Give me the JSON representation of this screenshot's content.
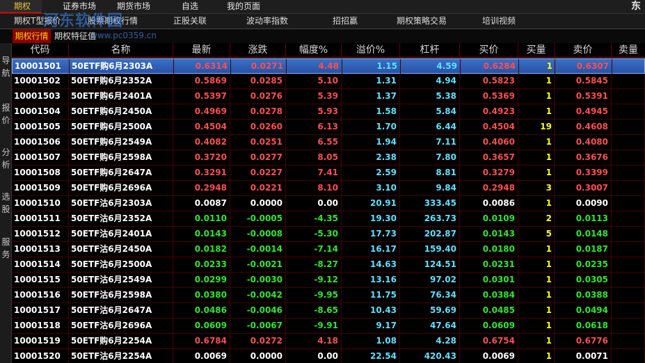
{
  "topbar": {
    "menus": [
      "期权",
      "证券市场",
      "期货市场",
      "自选",
      "我的页面"
    ],
    "brand_char": "东"
  },
  "tabbar": {
    "tabs": [
      "期权T型报价",
      "股票期权行情",
      "正股关联",
      "波动率指数",
      "招招赢",
      "期权策略交易",
      "培训视频"
    ]
  },
  "subbar": {
    "active": "期权行情",
    "other": "期权特征值"
  },
  "watermark": {
    "text": "河东软件园",
    "url": "www.pc0359.cn"
  },
  "sidebar": {
    "groups": [
      {
        "label": "导航",
        "chars": [
          "导",
          "航"
        ]
      },
      {
        "label": "报价",
        "chars": [
          "报",
          "价"
        ]
      },
      {
        "label": "分析",
        "chars": [
          "分",
          "析"
        ]
      },
      {
        "label": "选股",
        "chars": [
          "选",
          "股"
        ]
      },
      {
        "label": "服务",
        "chars": [
          "服",
          "务"
        ]
      }
    ]
  },
  "table": {
    "headers": [
      "代码",
      "名称",
      "最新",
      "涨跌",
      "幅度%",
      "溢价%",
      "杠杆",
      "买价",
      "买量",
      "卖价",
      "卖量"
    ],
    "rows": [
      {
        "code": "10001501",
        "name": "50ETF购6月2303A",
        "last": "0.6314",
        "chg": "0.0271",
        "pct": "4.48",
        "prem": "1.15",
        "lev": "4.59",
        "bid": "0.6284",
        "bidv": "1",
        "ask": "0.6307",
        "dir": "up"
      },
      {
        "code": "10001502",
        "name": "50ETF购6月2352A",
        "last": "0.5869",
        "chg": "0.0285",
        "pct": "5.10",
        "prem": "1.31",
        "lev": "4.94",
        "bid": "0.5823",
        "bidv": "1",
        "ask": "0.5845",
        "dir": "up"
      },
      {
        "code": "10001503",
        "name": "50ETF购6月2401A",
        "last": "0.5397",
        "chg": "0.0276",
        "pct": "5.39",
        "prem": "1.37",
        "lev": "5.38",
        "bid": "0.5369",
        "bidv": "1",
        "ask": "0.5391",
        "dir": "up"
      },
      {
        "code": "10001504",
        "name": "50ETF购6月2450A",
        "last": "0.4969",
        "chg": "0.0278",
        "pct": "5.93",
        "prem": "1.58",
        "lev": "5.84",
        "bid": "0.4923",
        "bidv": "1",
        "ask": "0.4945",
        "dir": "up"
      },
      {
        "code": "10001505",
        "name": "50ETF购6月2500A",
        "last": "0.4504",
        "chg": "0.0260",
        "pct": "6.13",
        "prem": "1.70",
        "lev": "6.44",
        "bid": "0.4504",
        "bidv": "19",
        "ask": "0.4608",
        "dir": "up"
      },
      {
        "code": "10001506",
        "name": "50ETF购6月2549A",
        "last": "0.4082",
        "chg": "0.0251",
        "pct": "6.55",
        "prem": "1.94",
        "lev": "7.11",
        "bid": "0.4060",
        "bidv": "1",
        "ask": "0.4080",
        "dir": "up"
      },
      {
        "code": "10001507",
        "name": "50ETF购6月2598A",
        "last": "0.3720",
        "chg": "0.0277",
        "pct": "8.05",
        "prem": "2.38",
        "lev": "7.80",
        "bid": "0.3657",
        "bidv": "1",
        "ask": "0.3676",
        "dir": "up"
      },
      {
        "code": "10001508",
        "name": "50ETF购6月2647A",
        "last": "0.3291",
        "chg": "0.0227",
        "pct": "7.41",
        "prem": "2.59",
        "lev": "8.81",
        "bid": "0.3279",
        "bidv": "1",
        "ask": "0.3399",
        "dir": "up"
      },
      {
        "code": "10001509",
        "name": "50ETF购6月2696A",
        "last": "0.2948",
        "chg": "0.0221",
        "pct": "8.10",
        "prem": "3.10",
        "lev": "9.84",
        "bid": "0.2948",
        "bidv": "3",
        "ask": "0.3007",
        "dir": "up"
      },
      {
        "code": "10001510",
        "name": "50ETF沽6月2303A",
        "last": "0.0087",
        "chg": "0.0000",
        "pct": "0.00",
        "prem": "20.91",
        "lev": "333.45",
        "bid": "0.0086",
        "bidv": "1",
        "ask": "0.0090",
        "dir": "flat"
      },
      {
        "code": "10001511",
        "name": "50ETF沽6月2352A",
        "last": "0.0110",
        "chg": "-0.0005",
        "pct": "-4.35",
        "prem": "19.30",
        "lev": "263.73",
        "bid": "0.0109",
        "bidv": "2",
        "ask": "0.0113",
        "dir": "down"
      },
      {
        "code": "10001512",
        "name": "50ETF沽6月2401A",
        "last": "0.0143",
        "chg": "-0.0008",
        "pct": "-5.30",
        "prem": "17.73",
        "lev": "202.87",
        "bid": "0.0143",
        "bidv": "5",
        "ask": "0.0148",
        "dir": "down"
      },
      {
        "code": "10001513",
        "name": "50ETF沽6月2450A",
        "last": "0.0182",
        "chg": "-0.0014",
        "pct": "-7.14",
        "prem": "16.17",
        "lev": "159.40",
        "bid": "0.0180",
        "bidv": "1",
        "ask": "0.0187",
        "dir": "down"
      },
      {
        "code": "10001514",
        "name": "50ETF沽6月2500A",
        "last": "0.0233",
        "chg": "-0.0021",
        "pct": "-8.27",
        "prem": "14.63",
        "lev": "124.51",
        "bid": "0.0231",
        "bidv": "1",
        "ask": "0.0235",
        "dir": "down"
      },
      {
        "code": "10001515",
        "name": "50ETF沽6月2549A",
        "last": "0.0299",
        "chg": "-0.0030",
        "pct": "-9.12",
        "prem": "13.16",
        "lev": "97.02",
        "bid": "0.0301",
        "bidv": "1",
        "ask": "0.0305",
        "dir": "down"
      },
      {
        "code": "10001516",
        "name": "50ETF沽6月2598A",
        "last": "0.0380",
        "chg": "-0.0042",
        "pct": "-9.95",
        "prem": "11.75",
        "lev": "76.34",
        "bid": "0.0384",
        "bidv": "1",
        "ask": "0.0388",
        "dir": "down"
      },
      {
        "code": "10001517",
        "name": "50ETF沽6月2647A",
        "last": "0.0486",
        "chg": "-0.0046",
        "pct": "-8.65",
        "prem": "10.43",
        "lev": "59.69",
        "bid": "0.0485",
        "bidv": "1",
        "ask": "0.0494",
        "dir": "down"
      },
      {
        "code": "10001518",
        "name": "50ETF沽6月2696A",
        "last": "0.0609",
        "chg": "-0.0067",
        "pct": "-9.91",
        "prem": "9.17",
        "lev": "47.64",
        "bid": "0.0609",
        "bidv": "1",
        "ask": "0.0618",
        "dir": "down"
      },
      {
        "code": "10001519",
        "name": "50ETF购6月2254A",
        "last": "0.6784",
        "chg": "0.0272",
        "pct": "4.18",
        "prem": "1.08",
        "lev": "4.28",
        "bid": "0.6754",
        "bidv": "1",
        "ask": "0.6776",
        "dir": "up"
      },
      {
        "code": "10001520",
        "name": "50ETF沽6月2254A",
        "last": "0.0069",
        "chg": "0.0000",
        "pct": "0.00",
        "prem": "22.54",
        "lev": "420.43",
        "bid": "0.0069",
        "bidv": "1",
        "ask": "0.0071",
        "dir": "flat"
      }
    ],
    "selected_row": 0
  },
  "colors": {
    "up": "#ff4d4d",
    "down": "#2ee62e",
    "flat": "#ffffff",
    "cyan": "#5fe0ff",
    "volume": "#ffff00",
    "selection": "#2653a8",
    "grid_line": "#4a0000",
    "active_menu": "#d40000"
  }
}
